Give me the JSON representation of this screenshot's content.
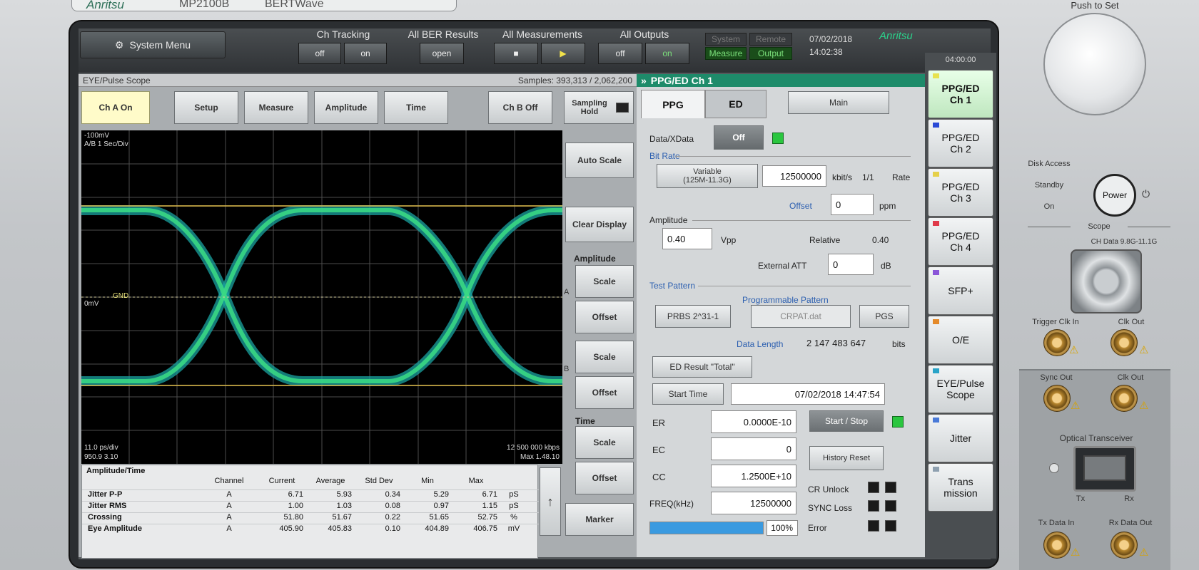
{
  "brand": {
    "logo_top": "Anritsu",
    "model_top": "MP2100B",
    "product_top": "BERTWave",
    "logo_screen": "Anritsu"
  },
  "hardware": {
    "knob_label": "Push to Set",
    "disk_access": "Disk Access",
    "standby": "Standby",
    "on": "On",
    "power": "Power",
    "scope_section": "Scope",
    "ch_data_input": "CH Data 9.8G-11.1G",
    "trigger_clk_in": "Trigger Clk In",
    "clk_out": "Clk Out",
    "sync_out": "Sync Out",
    "clk_out2": "Clk Out",
    "optical_transceiver": "Optical Transceiver",
    "tx": "Tx",
    "rx": "Rx",
    "tx_data_in": "Tx Data In",
    "rx_data_out": "Rx Data Out"
  },
  "topbar": {
    "system_menu": "System Menu",
    "ch_tracking": {
      "label": "Ch Tracking",
      "off": "off",
      "on": "on"
    },
    "all_ber_results": {
      "label": "All BER Results",
      "open": "open"
    },
    "all_measurements": {
      "label": "All Measurements",
      "stop": "■",
      "start": "▶"
    },
    "all_outputs": {
      "label": "All Outputs",
      "off": "off",
      "on": "on"
    },
    "indicators": {
      "system": "System",
      "remote": "Remote",
      "measure": "Measure",
      "output": "Output"
    },
    "date": "07/02/2018",
    "time": "14:02:38",
    "clock_small": "04:00:00"
  },
  "scope": {
    "title": "EYE/Pulse Scope",
    "samples": "Samples: 393,313 / 2,062,200",
    "buttons": {
      "ch_a_on": "Ch A On",
      "setup": "Setup",
      "measure": "Measure",
      "amplitude": "Amplitude",
      "time": "Time",
      "ch_b_off": "Ch B Off",
      "sampling_hold": "Sampling Hold",
      "auto_scale": "Auto Scale",
      "clear_display": "Clear Display",
      "amplitude_section": "Amplitude",
      "a_scale": "Scale",
      "a_offset": "Offset",
      "b_scale": "Scale",
      "b_offset": "Offset",
      "time_section": "Time",
      "t_scale": "Scale",
      "t_offset": "Offset",
      "marker": "Marker",
      "arrow_up": "↑",
      "ch_a_mark": "A",
      "ch_b_mark": "B"
    },
    "plot_labels": {
      "top_left_1": "-100mV",
      "top_left_2": "A/B 1 Sec/Div",
      "mid_left": "0mV",
      "mid_marker": "GND",
      "bottom_left_1": "11.0 ps/div",
      "bottom_left_2": "950.9 3.10",
      "bottom_right_1": "12 500 000 kbps",
      "bottom_right_2": "Max 1.48.10"
    },
    "table": {
      "title": "Amplitude/Time",
      "columns": [
        "Channel",
        "Current",
        "Average",
        "Std Dev",
        "Min",
        "Max",
        ""
      ],
      "rows": [
        {
          "name": "Jitter P-P",
          "cells": [
            "A",
            "6.71",
            "5.93",
            "0.34",
            "5.29",
            "6.71",
            "pS"
          ]
        },
        {
          "name": "Jitter RMS",
          "cells": [
            "A",
            "1.00",
            "1.03",
            "0.08",
            "0.97",
            "1.15",
            "pS"
          ]
        },
        {
          "name": "Crossing",
          "cells": [
            "A",
            "51.80",
            "51.67",
            "0.22",
            "51.65",
            "52.75",
            "%"
          ]
        },
        {
          "name": "Eye Amplitude",
          "cells": [
            "A",
            "405.90",
            "405.83",
            "0.10",
            "404.89",
            "406.75",
            "mV"
          ]
        }
      ]
    }
  },
  "ppg": {
    "title": "PPG/ED Ch 1",
    "tabs": {
      "ppg": "PPG",
      "ed": "ED"
    },
    "main": "Main",
    "data_xdata": "Data/XData",
    "off": "Off",
    "bit_rate_section": "Bit Rate",
    "variable": "Variable",
    "variable_sub": "(125M-11.3G)",
    "bit_rate_value": "12500000",
    "bit_rate_unit": "kbit/s",
    "ratio": "1/1",
    "rate": "Rate",
    "offset_label": "Offset",
    "offset_value": "0",
    "offset_unit": "ppm",
    "amplitude_section": "Amplitude",
    "amplitude_value": "0.40",
    "amplitude_unit": "Vpp",
    "relative_label": "Relative",
    "relative_value": "0.40",
    "external_att": "External ATT",
    "external_att_value": "0",
    "external_att_unit": "dB",
    "test_pattern_section": "Test Pattern",
    "programmable_pattern": "Programmable Pattern",
    "prbs": "PRBS 2^31-1",
    "pattern_file": "CRPAT.dat",
    "pgs": "PGS",
    "data_length_label": "Data Length",
    "data_length_value": "2 147 483 647",
    "data_length_unit": "bits",
    "ed_result": "ED Result \"Total\"",
    "start_time_label": "Start Time",
    "start_time_value": "07/02/2018 14:47:54",
    "er_label": "ER",
    "er_value": "0.0000E-10",
    "start_stop": "Start / Stop",
    "ec_label": "EC",
    "ec_value": "0",
    "history_reset": "History Reset",
    "cc_label": "CC",
    "cc_value": "1.2500E+10",
    "cr_unlock": "CR Unlock",
    "freq_label": "FREQ(kHz)",
    "freq_value": "12500000",
    "sync_loss": "SYNC Loss",
    "progress_text": "100%",
    "progress": 1.0,
    "error": "Error"
  },
  "sidetabs": [
    {
      "label": "PPG/ED\nCh 1",
      "chip": "#e7e24f"
    },
    {
      "label": "PPG/ED\nCh 2",
      "chip": "#2b4ad6"
    },
    {
      "label": "PPG/ED\nCh 3",
      "chip": "#e5d04a"
    },
    {
      "label": "PPG/ED\nCh 4",
      "chip": "#e03a4a"
    },
    {
      "label": "SFP+",
      "chip": "#8a55d8"
    },
    {
      "label": "O/E",
      "chip": "#e48a2a"
    },
    {
      "label": "EYE/Pulse\nScope",
      "chip": "#2aa4c8"
    },
    {
      "label": "Jitter",
      "chip": "#4a7ad8"
    },
    {
      "label": "Trans\nmission",
      "chip": "#8ea0b0"
    }
  ],
  "colors": {
    "accent_green": "#1e8b6a",
    "eye_green": "#2bd18b",
    "eye_yellow": "#d9c94f",
    "progress_blue": "#3a9ae0"
  }
}
